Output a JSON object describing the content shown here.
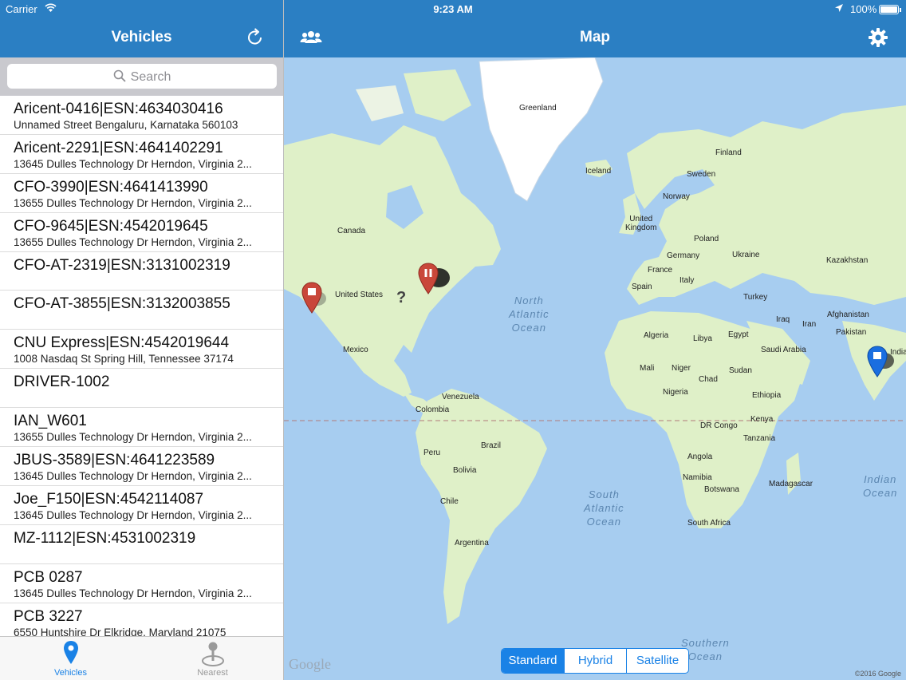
{
  "status_bar": {
    "carrier": "Carrier",
    "time": "9:23 AM",
    "battery": "100%"
  },
  "left_panel": {
    "title": "Vehicles",
    "search_placeholder": "Search",
    "vehicles": [
      {
        "name": "Aricent-0416|ESN:4634030416",
        "address": "Unnamed Street  Bengaluru, Karnataka 560103"
      },
      {
        "name": "Aricent-2291|ESN:4641402291",
        "address": "13645 Dulles Technology Dr  Herndon, Virginia 2..."
      },
      {
        "name": "CFO-3990|ESN:4641413990",
        "address": "13655 Dulles Technology Dr  Herndon, Virginia 2..."
      },
      {
        "name": "CFO-9645|ESN:4542019645",
        "address": "13655 Dulles Technology Dr  Herndon, Virginia 2..."
      },
      {
        "name": "CFO-AT-2319|ESN:3131002319",
        "address": ""
      },
      {
        "name": "CFO-AT-3855|ESN:3132003855",
        "address": ""
      },
      {
        "name": "CNU Express|ESN:4542019644",
        "address": "1008 Nasdaq St  Spring Hill, Tennessee 37174"
      },
      {
        "name": "DRIVER-1002",
        "address": ""
      },
      {
        "name": "IAN_W601",
        "address": "13655 Dulles Technology Dr  Herndon, Virginia 2..."
      },
      {
        "name": "JBUS-3589|ESN:4641223589",
        "address": "13645 Dulles Technology Dr  Herndon, Virginia 2..."
      },
      {
        "name": "Joe_F150|ESN:4542114087",
        "address": "13645 Dulles Technology Dr  Herndon, Virginia 2..."
      },
      {
        "name": "MZ-1112|ESN:4531002319",
        "address": ""
      },
      {
        "name": "PCB 0287",
        "address": "13645 Dulles Technology Dr  Herndon, Virginia 2..."
      },
      {
        "name": "PCB 3227",
        "address": "6550 Huntshire Dr  Elkridge, Maryland 21075"
      }
    ],
    "tabs": {
      "vehicles": "Vehicles",
      "nearest": "Nearest"
    }
  },
  "map_panel": {
    "title": "Map",
    "labels": {
      "greenland": "Greenland",
      "iceland": "Iceland",
      "finland": "Finland",
      "sweden": "Sweden",
      "norway": "Norway",
      "uk": "United\nKingdom",
      "poland": "Poland",
      "germany": "Germany",
      "ukraine": "Ukraine",
      "kazakhstan": "Kazakhstan",
      "france": "France",
      "italy": "Italy",
      "spain": "Spain",
      "turkey": "Turkey",
      "afghanistan": "Afghanistan",
      "iraq": "Iraq",
      "iran": "Iran",
      "pakistan": "Pakistan",
      "canada": "Canada",
      "united_states": "United States",
      "mexico": "Mexico",
      "algeria": "Algeria",
      "libya": "Libya",
      "egypt": "Egypt",
      "saudi_arabia": "Saudi Arabia",
      "mali": "Mali",
      "niger": "Niger",
      "chad": "Chad",
      "sudan": "Sudan",
      "nigeria": "Nigeria",
      "ethiopia": "Ethiopia",
      "kenya": "Kenya",
      "dr_congo": "DR Congo",
      "tanzania": "Tanzania",
      "angola": "Angola",
      "namibia": "Namibia",
      "botswana": "Botswana",
      "madagascar": "Madagascar",
      "south_africa": "South Africa",
      "venezuela": "Venezuela",
      "colombia": "Colombia",
      "peru": "Peru",
      "brazil": "Brazil",
      "bolivia": "Bolivia",
      "chile": "Chile",
      "argentina": "Argentina",
      "india": "India"
    },
    "oceans": {
      "north_atlantic": "North\nAtlantic\nOcean",
      "south_atlantic": "South\nAtlantic\nOcean",
      "indian": "Indian\nOcean",
      "southern": "Southern\nOcean"
    },
    "google_logo": "Google",
    "copyright": "©2016 Google",
    "map_types": [
      "Standard",
      "Hybrid",
      "Satellite"
    ],
    "selected_map_type": "Standard"
  },
  "colors": {
    "bar": "#2b7fc3",
    "accent": "#1a82e6",
    "water": "#a7cdf0",
    "land": "#dff0c8"
  }
}
